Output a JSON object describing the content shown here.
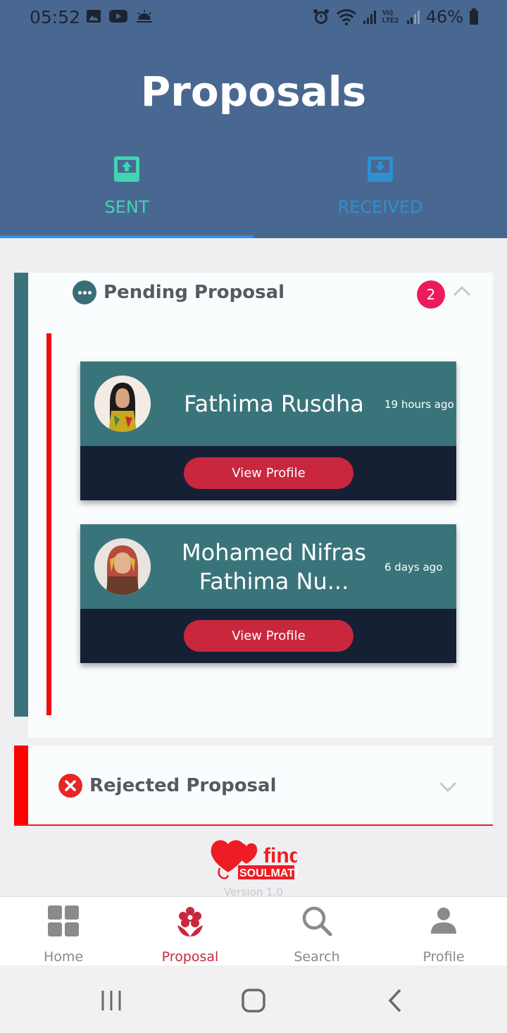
{
  "status_bar": {
    "time": "05:52",
    "battery": "46%",
    "network_label": "Vo) LTE2"
  },
  "header": {
    "title": "Proposals",
    "tabs": [
      {
        "label": "SENT",
        "icon": "upload-tray-icon",
        "active": true
      },
      {
        "label": "RECEIVED",
        "icon": "download-tray-icon",
        "active": false
      }
    ]
  },
  "pending": {
    "title": "Pending Proposal",
    "count": "2",
    "proposals": [
      {
        "name": "Fathima Rusdha",
        "time": "19 hours ago",
        "button": "View Profile"
      },
      {
        "name": "Mohamed Nifras Fathima Nu...",
        "time": "6 days ago",
        "button": "View Profile"
      }
    ]
  },
  "rejected": {
    "title": "Rejected Proposal"
  },
  "logo": {
    "text_find": "find",
    "text_brand": "SOULMATE"
  },
  "version": "Version 1.0",
  "bottom_nav": [
    {
      "label": "Home",
      "icon": "grid-icon",
      "active": false
    },
    {
      "label": "Proposal",
      "icon": "flower-icon",
      "active": true
    },
    {
      "label": "Search",
      "icon": "search-icon",
      "active": false
    },
    {
      "label": "Profile",
      "icon": "person-icon",
      "active": false
    }
  ],
  "colors": {
    "header": "#496891",
    "accent_teal": "#40d4b4",
    "accent_red": "#c8273e",
    "badge": "#ec1c5a"
  }
}
